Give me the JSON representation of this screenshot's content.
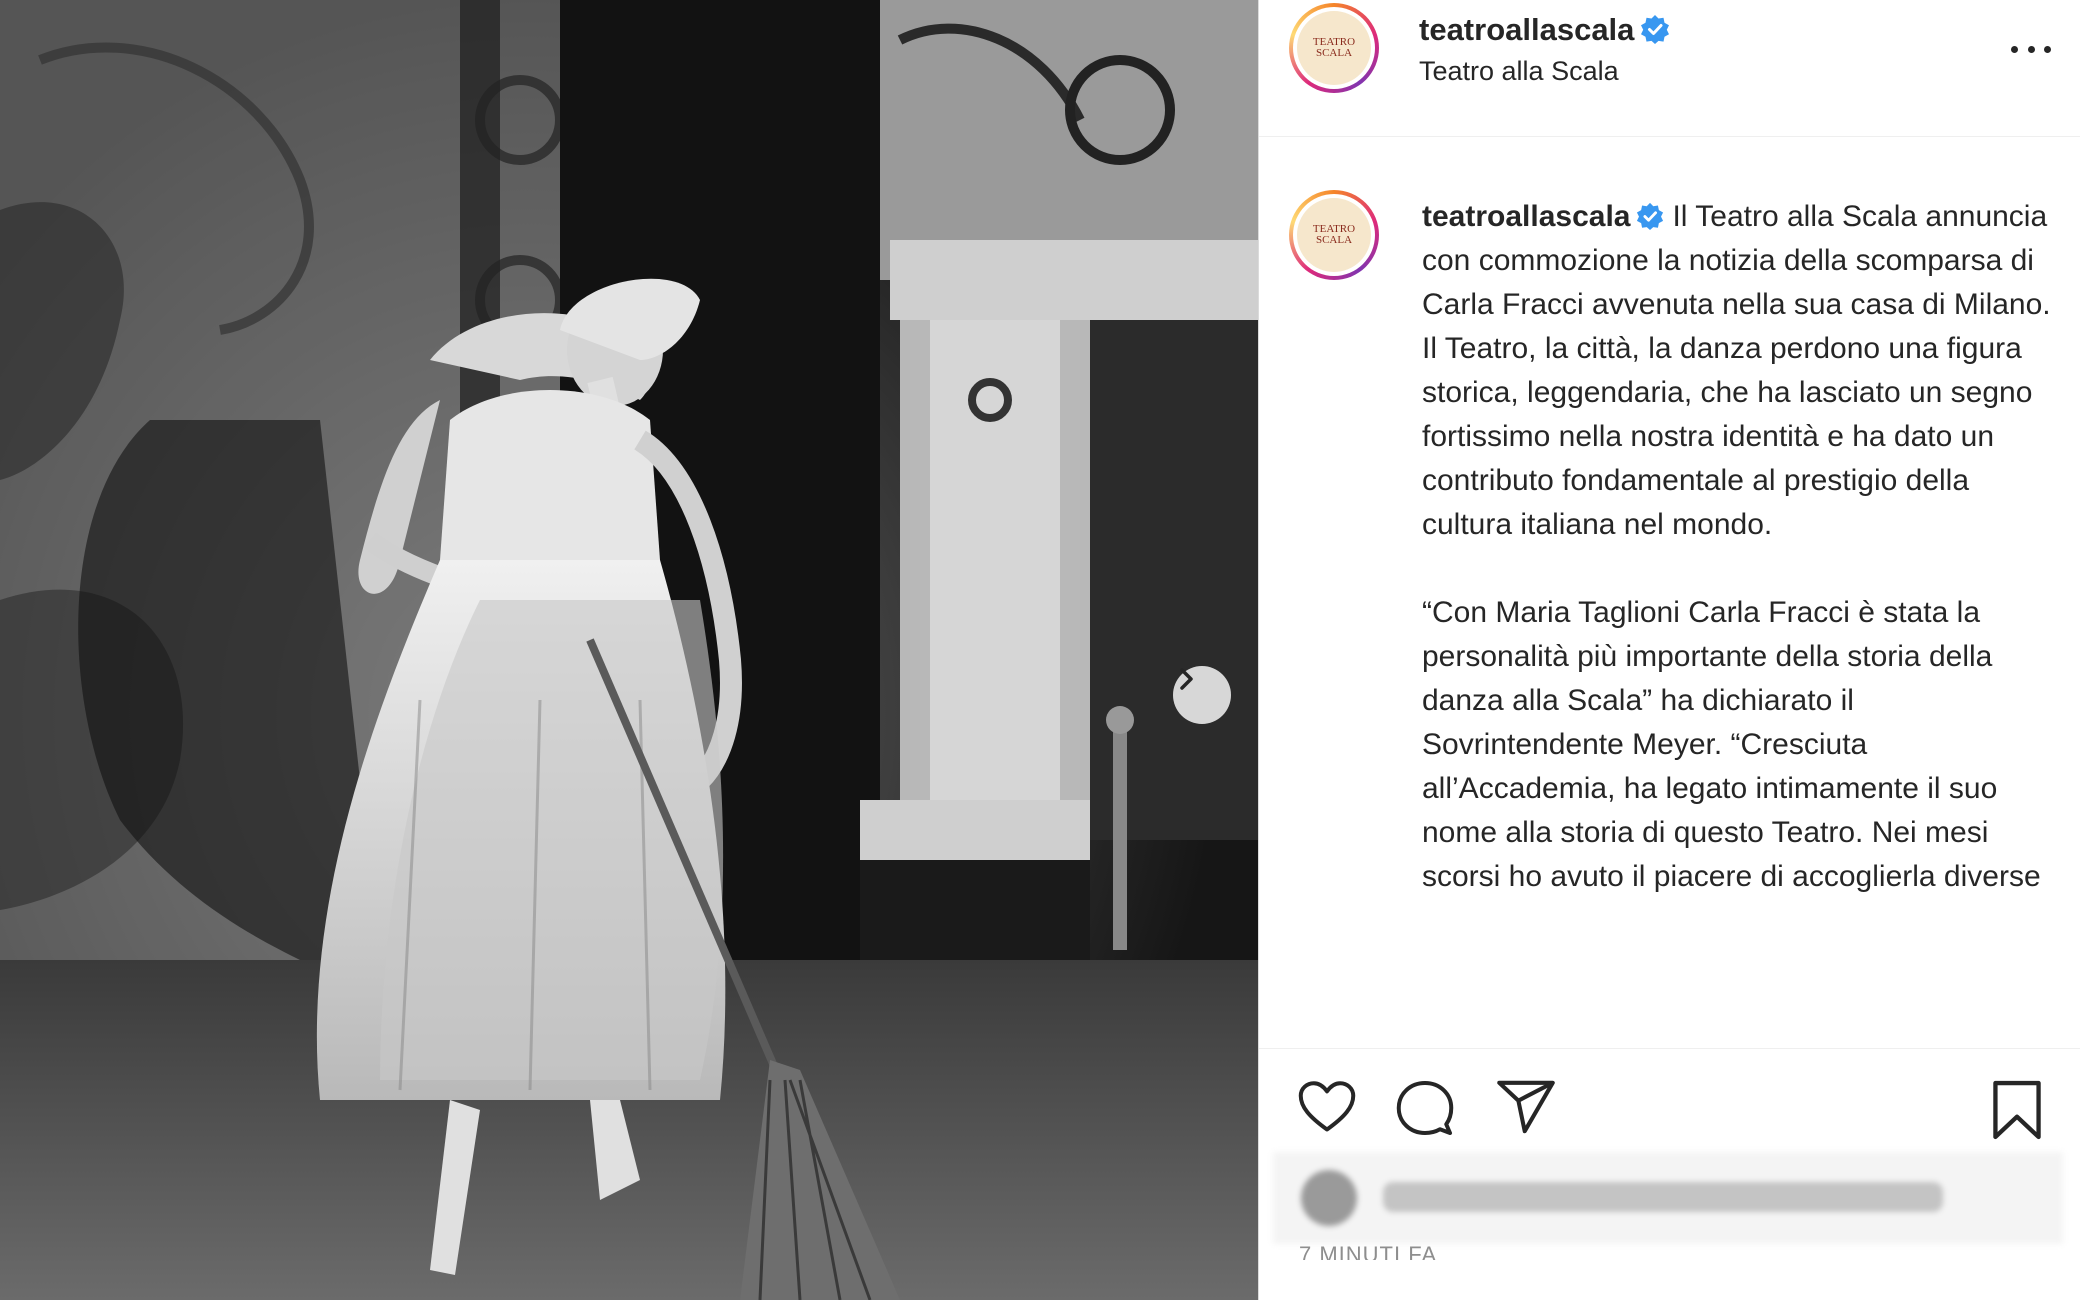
{
  "post": {
    "account": {
      "username": "teatroallascala",
      "display_name": "Teatro alla Scala",
      "verified": true
    },
    "caption": {
      "username": "teatroallascala",
      "paragraph1": "Il Teatro alla Scala annuncia con commozione la notizia della scomparsa di Carla Fracci avvenuta nella sua casa di Milano. Il Teatro, la città, la danza perdono una figura storica, leggendaria, che ha lasciato un segno fortissimo nella nostra identità e ha dato un contributo fondamentale al prestigio della cultura italiana nel mondo.",
      "paragraph2": "“Con Maria Taglioni Carla Fracci è stata la personalità più importante della storia della danza alla Scala” ha dichiarato il Sovrintendente Meyer. “Cresciuta all’Accademia, ha legato intimamente il suo nome alla storia di questo Teatro. Nei mesi scorsi ho avuto il piacere di accoglierla diverse"
    },
    "timestamp": "7 MINUTI FA",
    "icons": {
      "more": "more-options-icon",
      "next": "chevron-right-icon",
      "like": "heart-icon",
      "comment": "comment-icon",
      "share": "send-icon",
      "save": "bookmark-icon",
      "verified": "verified-badge-icon"
    },
    "colors": {
      "verified": "#3897f0",
      "text": "#262626",
      "secondary": "#8e8e8e"
    }
  }
}
